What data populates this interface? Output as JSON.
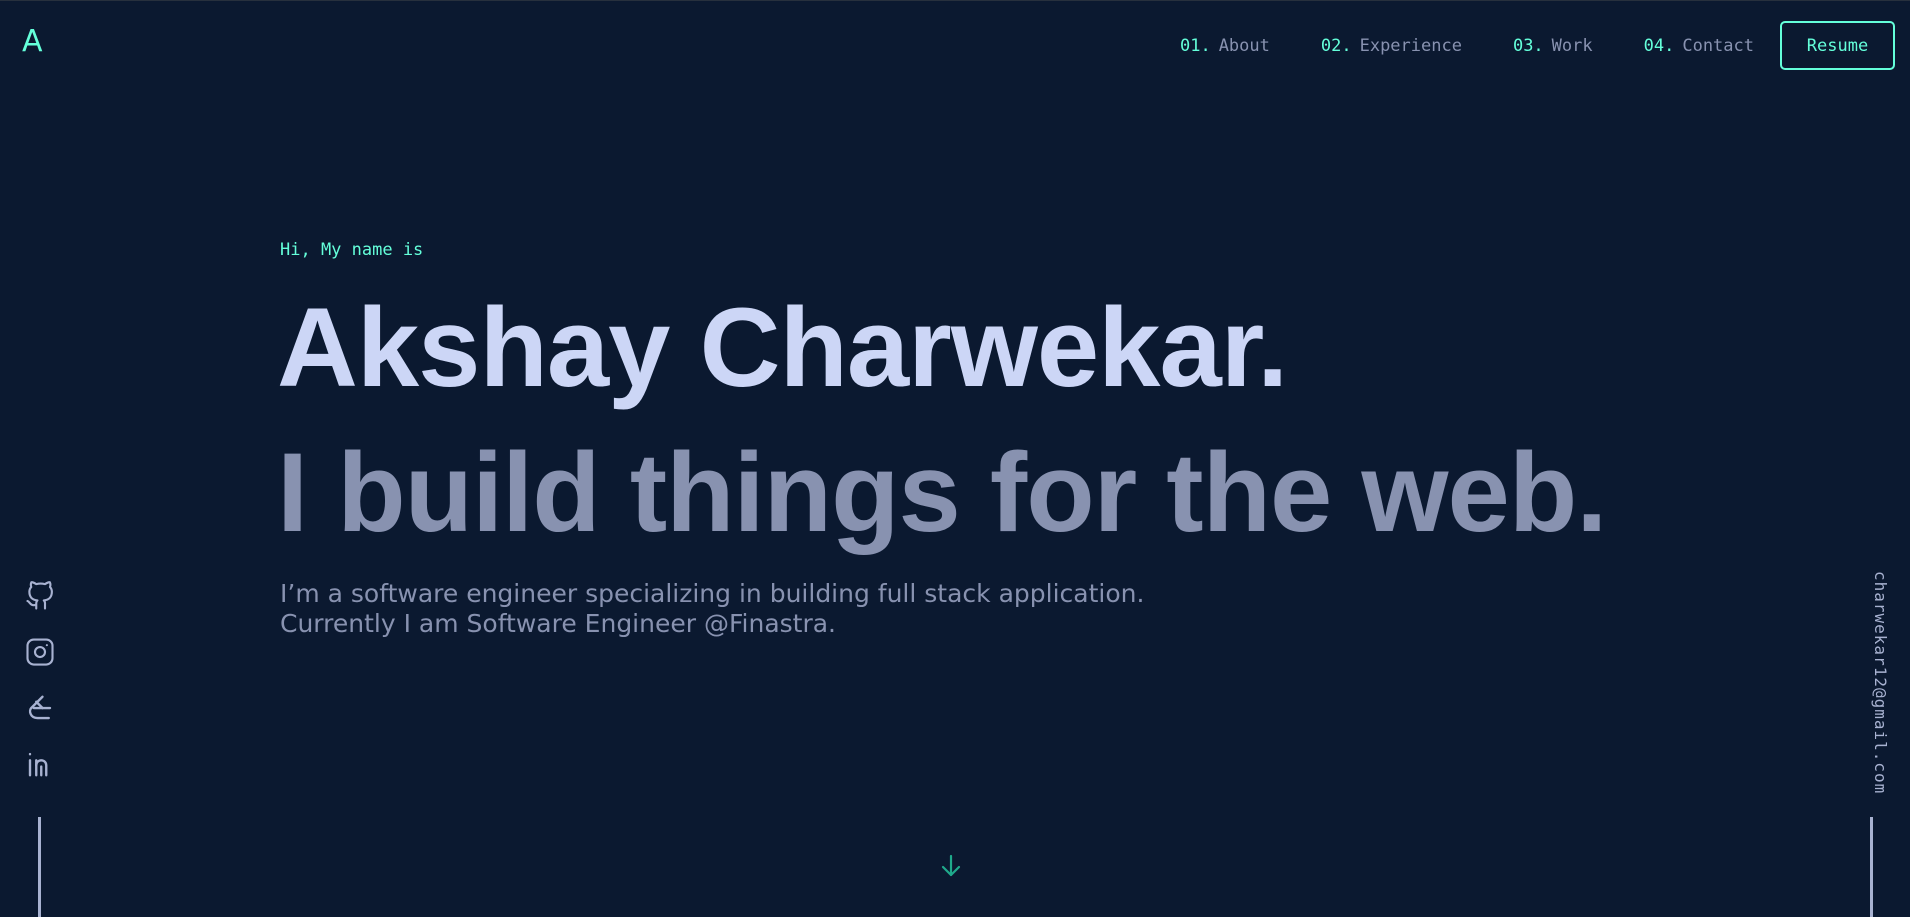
{
  "logo": {
    "text": "A"
  },
  "nav": {
    "items": [
      {
        "num": "01.",
        "label": "About"
      },
      {
        "num": "02.",
        "label": "Experience"
      },
      {
        "num": "03.",
        "label": "Work"
      },
      {
        "num": "04.",
        "label": "Contact"
      }
    ],
    "resume_label": "Resume"
  },
  "hero": {
    "greeting": "Hi, My name is",
    "name": "Akshay Charwekar.",
    "tagline": "I build things for the web.",
    "description_line1": "I’m a software engineer specializing in building full stack application.",
    "description_line2": "Currently I am Software Engineer @Finastra."
  },
  "social": {
    "icons": [
      "github-icon",
      "instagram-icon",
      "codepen-icon",
      "linkedin-icon"
    ]
  },
  "email": "charwekar12@gmail.com",
  "colors": {
    "background": "#0b1930",
    "accent": "#64ffda",
    "heading": "#ccd6f6",
    "text": "#8892b0",
    "sidebar": "#a8b2d1"
  }
}
